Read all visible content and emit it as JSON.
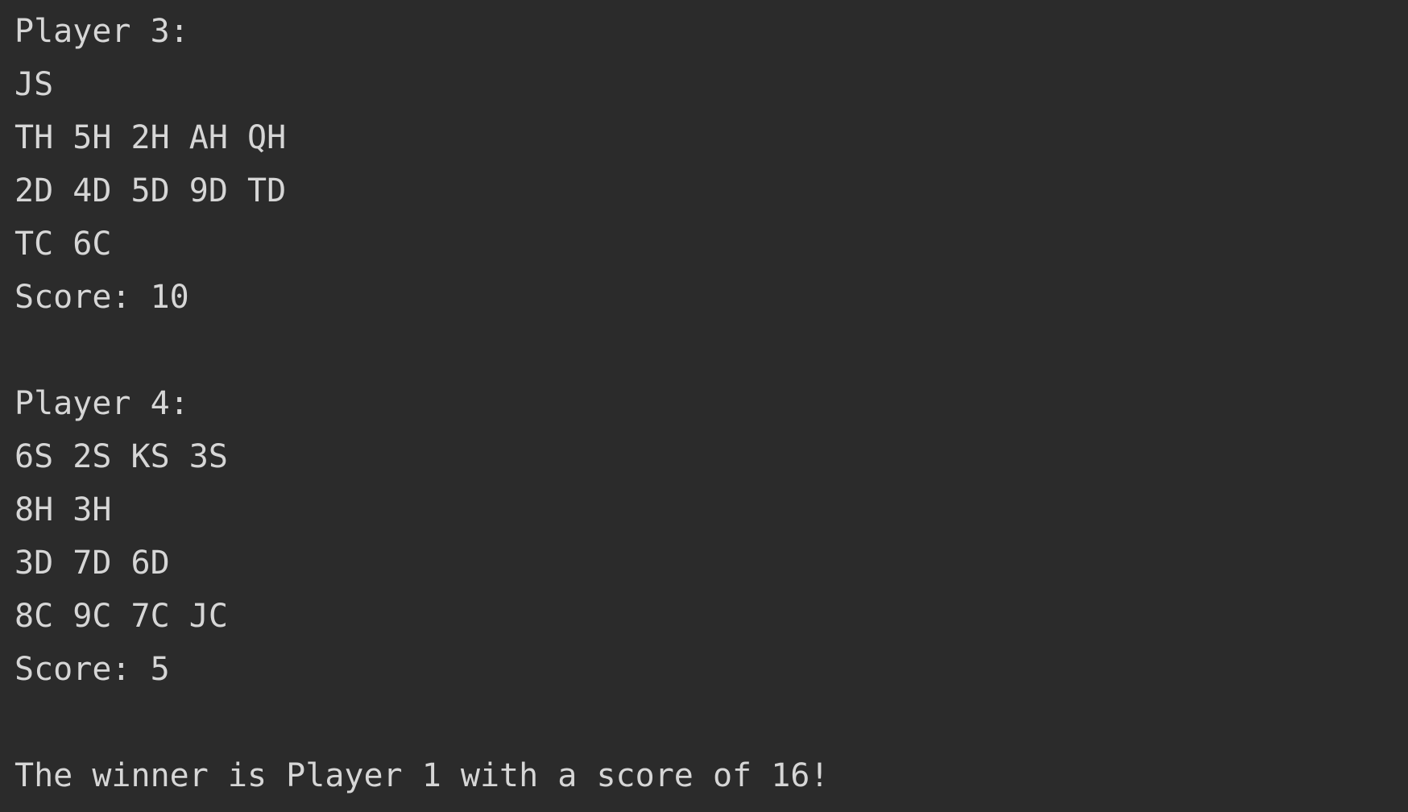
{
  "console": {
    "lines": [
      "Player 3:",
      "JS",
      "TH 5H 2H AH QH",
      "2D 4D 5D 9D TD",
      "TC 6C",
      "Score: 10",
      "",
      "Player 4:",
      "6S 2S KS 3S",
      "8H 3H",
      "3D 7D 6D",
      "8C 9C 7C JC",
      "Score: 5",
      "",
      "The winner is Player 1 with a score of 16!"
    ]
  }
}
